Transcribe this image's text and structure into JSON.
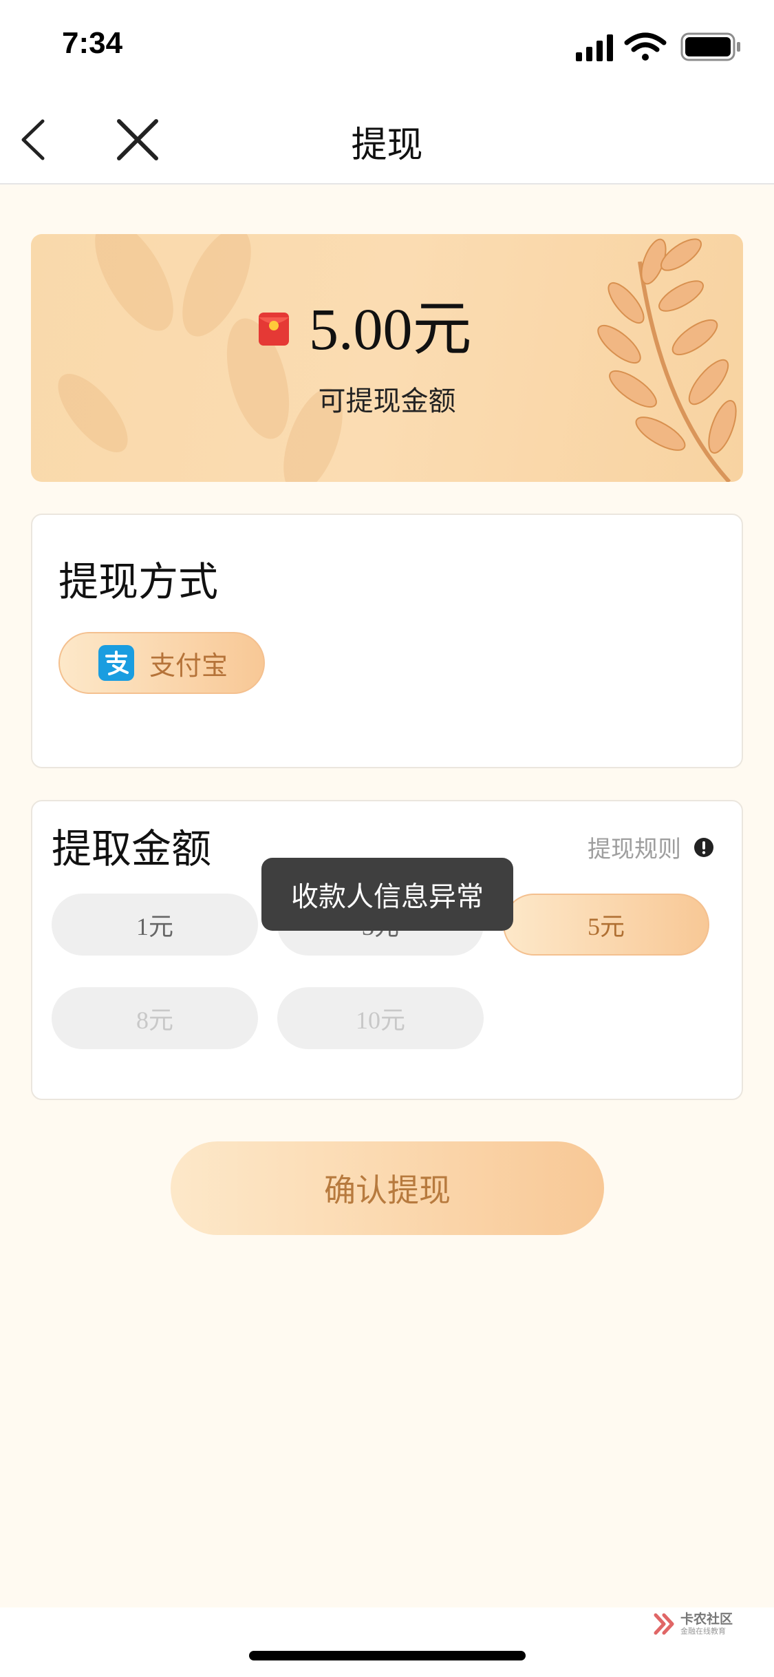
{
  "status_bar": {
    "time": "7:34"
  },
  "nav": {
    "title": "提现"
  },
  "balance": {
    "amount": "5.00元",
    "label": "可提现金额"
  },
  "method": {
    "title": "提现方式",
    "selected_method": "支付宝"
  },
  "amount_section": {
    "title": "提取金额",
    "rules_label": "提现规则",
    "options": [
      {
        "label": "1元",
        "state": "available"
      },
      {
        "label": "3元",
        "state": "available"
      },
      {
        "label": "5元",
        "state": "selected"
      },
      {
        "label": "8元",
        "state": "disabled"
      },
      {
        "label": "10元",
        "state": "disabled"
      }
    ]
  },
  "toast": {
    "message": "收款人信息异常"
  },
  "confirm": {
    "label": "确认提现"
  },
  "watermark": {
    "name": "卡农社区",
    "sub": "金融在线教育"
  },
  "colors": {
    "page_background": "#fffaf1",
    "accent_text": "#b77a3e",
    "pill_gradient_start": "#fde8c9",
    "pill_gradient_end": "#f8c896",
    "alipay_blue": "#1a9de0",
    "toast_background": "#3f3f3f"
  },
  "icons": {
    "back": "chevron-left-icon",
    "close": "close-icon",
    "red_packet": "red-packet-icon",
    "alipay": "alipay-icon",
    "info": "info-icon"
  }
}
